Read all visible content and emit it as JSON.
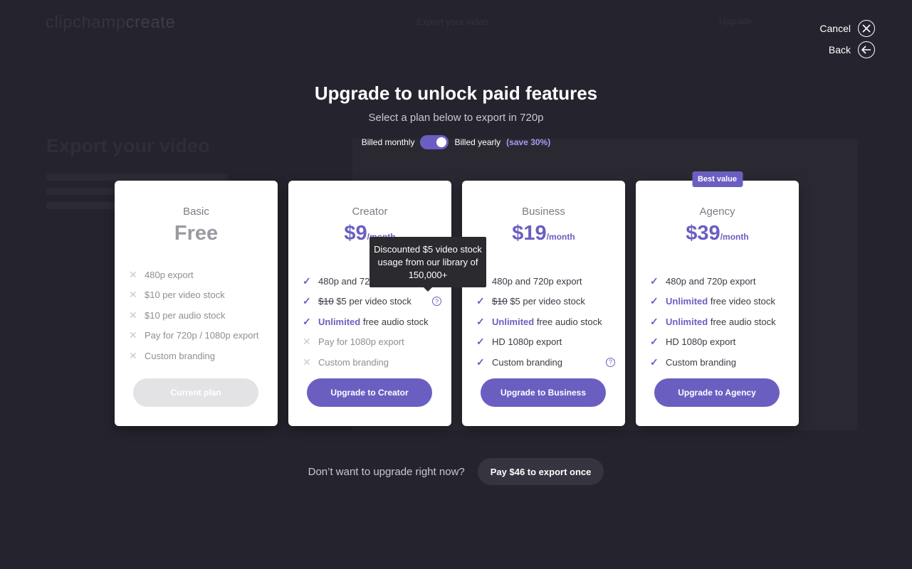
{
  "background": {
    "logo_part1": "clipchamp",
    "logo_part2": "create",
    "center_title": "Export your video",
    "top_right": "Upgrade",
    "heading": "Export your video"
  },
  "controls": {
    "cancel_label": "Cancel",
    "back_label": "Back"
  },
  "header": {
    "title": "Upgrade to unlock paid features",
    "subtitle": "Select a plan below to export in 720p"
  },
  "billing": {
    "monthly_label": "Billed monthly",
    "yearly_label": "Billed yearly",
    "save_label": "(save 30%)",
    "yearly_selected": true
  },
  "plans": [
    {
      "name": "Basic",
      "price": "Free",
      "per": "",
      "features": [
        {
          "on": false,
          "text": "480p export"
        },
        {
          "on": false,
          "text": "$10 per video stock"
        },
        {
          "on": false,
          "text": "$10 per audio stock"
        },
        {
          "on": false,
          "text": "Pay for 720p / 1080p export"
        },
        {
          "on": false,
          "text": "Custom branding"
        }
      ],
      "cta": "Current plan"
    },
    {
      "name": "Creator",
      "price": "$9",
      "per": "/month",
      "features": [
        {
          "on": true,
          "text": "480p and 720p export"
        },
        {
          "on": true,
          "strike": "$10",
          "text": "$5 per video stock"
        },
        {
          "on": true,
          "strong": "Unlimited",
          "text": "free audio stock"
        },
        {
          "on": false,
          "text": "Pay for 1080p export"
        },
        {
          "on": false,
          "text": "Custom branding"
        }
      ],
      "cta": "Upgrade to Creator"
    },
    {
      "name": "Business",
      "price": "$19",
      "per": "/month",
      "features": [
        {
          "on": true,
          "text": "480p and 720p export"
        },
        {
          "on": true,
          "strike": "$10",
          "text": "$5 per video stock"
        },
        {
          "on": true,
          "strong": "Unlimited",
          "text": "free audio stock"
        },
        {
          "on": true,
          "text": "HD 1080p export"
        },
        {
          "on": true,
          "text": "Custom branding"
        }
      ],
      "cta": "Upgrade to Business"
    },
    {
      "name": "Agency",
      "price": "$39",
      "per": "/month",
      "badge": "Best value",
      "features": [
        {
          "on": true,
          "text": "480p and 720p export"
        },
        {
          "on": true,
          "strong": "Unlimited",
          "text": "free video stock"
        },
        {
          "on": true,
          "strong": "Unlimited",
          "text": "free audio stock"
        },
        {
          "on": true,
          "text": "HD 1080p export"
        },
        {
          "on": true,
          "text": "Custom branding"
        }
      ],
      "cta": "Upgrade to Agency"
    }
  ],
  "tooltip": "Discounted $5 video stock usage from our library of 150,000+",
  "footer": {
    "question": "Don’t want to upgrade right now?",
    "pay_label": "Pay $46 to export once"
  },
  "colors": {
    "accent": "#6a5fc1",
    "background": "#25242e",
    "card": "#ffffff"
  }
}
